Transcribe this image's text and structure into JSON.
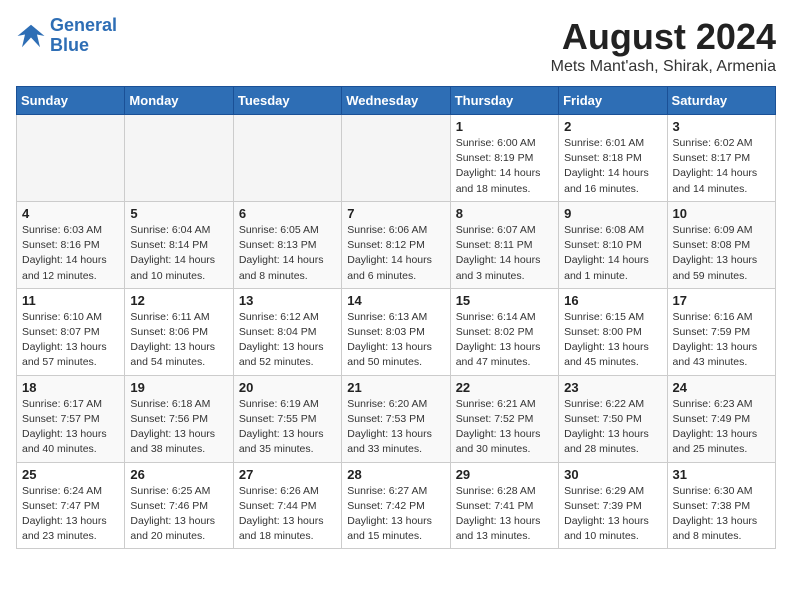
{
  "logo": {
    "line1": "General",
    "line2": "Blue"
  },
  "title": "August 2024",
  "location": "Mets Mant'ash, Shirak, Armenia",
  "days_of_week": [
    "Sunday",
    "Monday",
    "Tuesday",
    "Wednesday",
    "Thursday",
    "Friday",
    "Saturday"
  ],
  "weeks": [
    [
      {
        "num": "",
        "info": ""
      },
      {
        "num": "",
        "info": ""
      },
      {
        "num": "",
        "info": ""
      },
      {
        "num": "",
        "info": ""
      },
      {
        "num": "1",
        "info": "Sunrise: 6:00 AM\nSunset: 8:19 PM\nDaylight: 14 hours\nand 18 minutes."
      },
      {
        "num": "2",
        "info": "Sunrise: 6:01 AM\nSunset: 8:18 PM\nDaylight: 14 hours\nand 16 minutes."
      },
      {
        "num": "3",
        "info": "Sunrise: 6:02 AM\nSunset: 8:17 PM\nDaylight: 14 hours\nand 14 minutes."
      }
    ],
    [
      {
        "num": "4",
        "info": "Sunrise: 6:03 AM\nSunset: 8:16 PM\nDaylight: 14 hours\nand 12 minutes."
      },
      {
        "num": "5",
        "info": "Sunrise: 6:04 AM\nSunset: 8:14 PM\nDaylight: 14 hours\nand 10 minutes."
      },
      {
        "num": "6",
        "info": "Sunrise: 6:05 AM\nSunset: 8:13 PM\nDaylight: 14 hours\nand 8 minutes."
      },
      {
        "num": "7",
        "info": "Sunrise: 6:06 AM\nSunset: 8:12 PM\nDaylight: 14 hours\nand 6 minutes."
      },
      {
        "num": "8",
        "info": "Sunrise: 6:07 AM\nSunset: 8:11 PM\nDaylight: 14 hours\nand 3 minutes."
      },
      {
        "num": "9",
        "info": "Sunrise: 6:08 AM\nSunset: 8:10 PM\nDaylight: 14 hours\nand 1 minute."
      },
      {
        "num": "10",
        "info": "Sunrise: 6:09 AM\nSunset: 8:08 PM\nDaylight: 13 hours\nand 59 minutes."
      }
    ],
    [
      {
        "num": "11",
        "info": "Sunrise: 6:10 AM\nSunset: 8:07 PM\nDaylight: 13 hours\nand 57 minutes."
      },
      {
        "num": "12",
        "info": "Sunrise: 6:11 AM\nSunset: 8:06 PM\nDaylight: 13 hours\nand 54 minutes."
      },
      {
        "num": "13",
        "info": "Sunrise: 6:12 AM\nSunset: 8:04 PM\nDaylight: 13 hours\nand 52 minutes."
      },
      {
        "num": "14",
        "info": "Sunrise: 6:13 AM\nSunset: 8:03 PM\nDaylight: 13 hours\nand 50 minutes."
      },
      {
        "num": "15",
        "info": "Sunrise: 6:14 AM\nSunset: 8:02 PM\nDaylight: 13 hours\nand 47 minutes."
      },
      {
        "num": "16",
        "info": "Sunrise: 6:15 AM\nSunset: 8:00 PM\nDaylight: 13 hours\nand 45 minutes."
      },
      {
        "num": "17",
        "info": "Sunrise: 6:16 AM\nSunset: 7:59 PM\nDaylight: 13 hours\nand 43 minutes."
      }
    ],
    [
      {
        "num": "18",
        "info": "Sunrise: 6:17 AM\nSunset: 7:57 PM\nDaylight: 13 hours\nand 40 minutes."
      },
      {
        "num": "19",
        "info": "Sunrise: 6:18 AM\nSunset: 7:56 PM\nDaylight: 13 hours\nand 38 minutes."
      },
      {
        "num": "20",
        "info": "Sunrise: 6:19 AM\nSunset: 7:55 PM\nDaylight: 13 hours\nand 35 minutes."
      },
      {
        "num": "21",
        "info": "Sunrise: 6:20 AM\nSunset: 7:53 PM\nDaylight: 13 hours\nand 33 minutes."
      },
      {
        "num": "22",
        "info": "Sunrise: 6:21 AM\nSunset: 7:52 PM\nDaylight: 13 hours\nand 30 minutes."
      },
      {
        "num": "23",
        "info": "Sunrise: 6:22 AM\nSunset: 7:50 PM\nDaylight: 13 hours\nand 28 minutes."
      },
      {
        "num": "24",
        "info": "Sunrise: 6:23 AM\nSunset: 7:49 PM\nDaylight: 13 hours\nand 25 minutes."
      }
    ],
    [
      {
        "num": "25",
        "info": "Sunrise: 6:24 AM\nSunset: 7:47 PM\nDaylight: 13 hours\nand 23 minutes."
      },
      {
        "num": "26",
        "info": "Sunrise: 6:25 AM\nSunset: 7:46 PM\nDaylight: 13 hours\nand 20 minutes."
      },
      {
        "num": "27",
        "info": "Sunrise: 6:26 AM\nSunset: 7:44 PM\nDaylight: 13 hours\nand 18 minutes."
      },
      {
        "num": "28",
        "info": "Sunrise: 6:27 AM\nSunset: 7:42 PM\nDaylight: 13 hours\nand 15 minutes."
      },
      {
        "num": "29",
        "info": "Sunrise: 6:28 AM\nSunset: 7:41 PM\nDaylight: 13 hours\nand 13 minutes."
      },
      {
        "num": "30",
        "info": "Sunrise: 6:29 AM\nSunset: 7:39 PM\nDaylight: 13 hours\nand 10 minutes."
      },
      {
        "num": "31",
        "info": "Sunrise: 6:30 AM\nSunset: 7:38 PM\nDaylight: 13 hours\nand 8 minutes."
      }
    ]
  ]
}
